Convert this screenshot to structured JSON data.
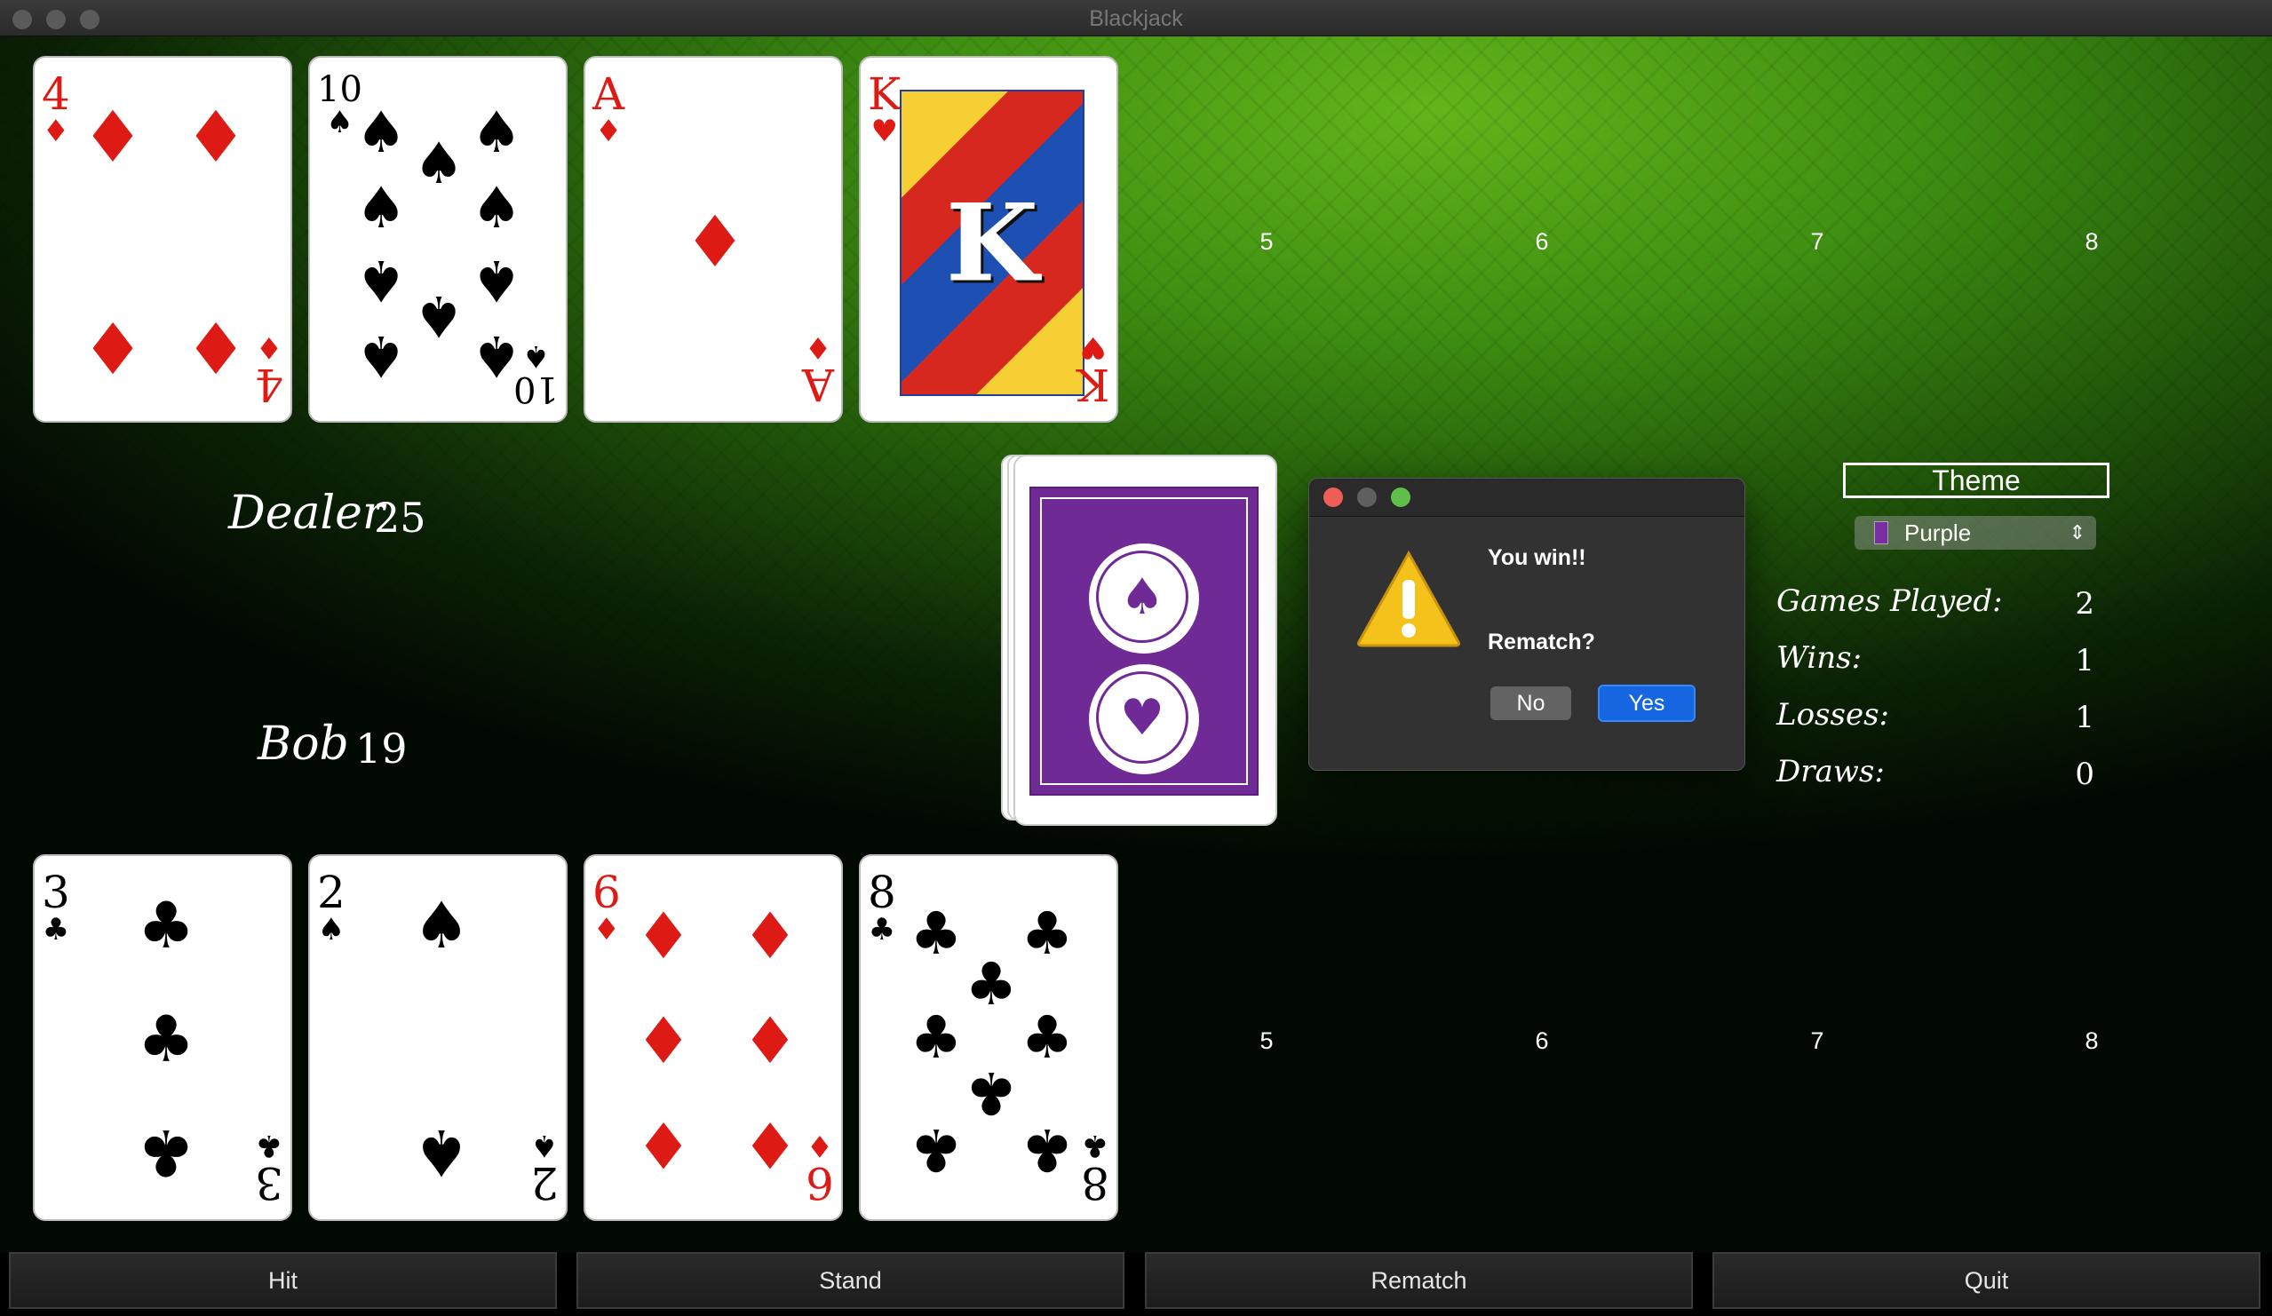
{
  "window": {
    "title": "Blackjack"
  },
  "dealer": {
    "name": "Dealer",
    "score": "25",
    "cards": [
      {
        "rank": "4",
        "suit": "♦",
        "color": "red"
      },
      {
        "rank": "10",
        "suit": "♠",
        "color": "black"
      },
      {
        "rank": "A",
        "suit": "♦",
        "color": "red"
      },
      {
        "rank": "K",
        "suit": "♥",
        "color": "red"
      }
    ],
    "empty_slots": [
      "5",
      "6",
      "7",
      "8"
    ]
  },
  "player": {
    "name": "Bob",
    "score": "19",
    "cards": [
      {
        "rank": "3",
        "suit": "♣",
        "color": "black"
      },
      {
        "rank": "2",
        "suit": "♠",
        "color": "black"
      },
      {
        "rank": "6",
        "suit": "♦",
        "color": "red"
      },
      {
        "rank": "8",
        "suit": "♣",
        "color": "black"
      }
    ],
    "empty_slots": [
      "5",
      "6",
      "7",
      "8"
    ]
  },
  "deck": {
    "back_color": "#6f2a96",
    "emblem_top": "♠",
    "emblem_bottom": "♥"
  },
  "dialog": {
    "message": "You win!!",
    "question": "Rematch?",
    "no_label": "No",
    "yes_label": "Yes"
  },
  "theme": {
    "label": "Theme",
    "selected": "Purple",
    "swatch_color": "#7a2ea6"
  },
  "stats": {
    "games_played_label": "Games Played:",
    "games_played": "2",
    "wins_label": "Wins:",
    "wins": "1",
    "losses_label": "Losses:",
    "losses": "1",
    "draws_label": "Draws:",
    "draws": "0"
  },
  "buttons": {
    "hit": "Hit",
    "stand": "Stand",
    "rematch": "Rematch",
    "quit": "Quit"
  }
}
